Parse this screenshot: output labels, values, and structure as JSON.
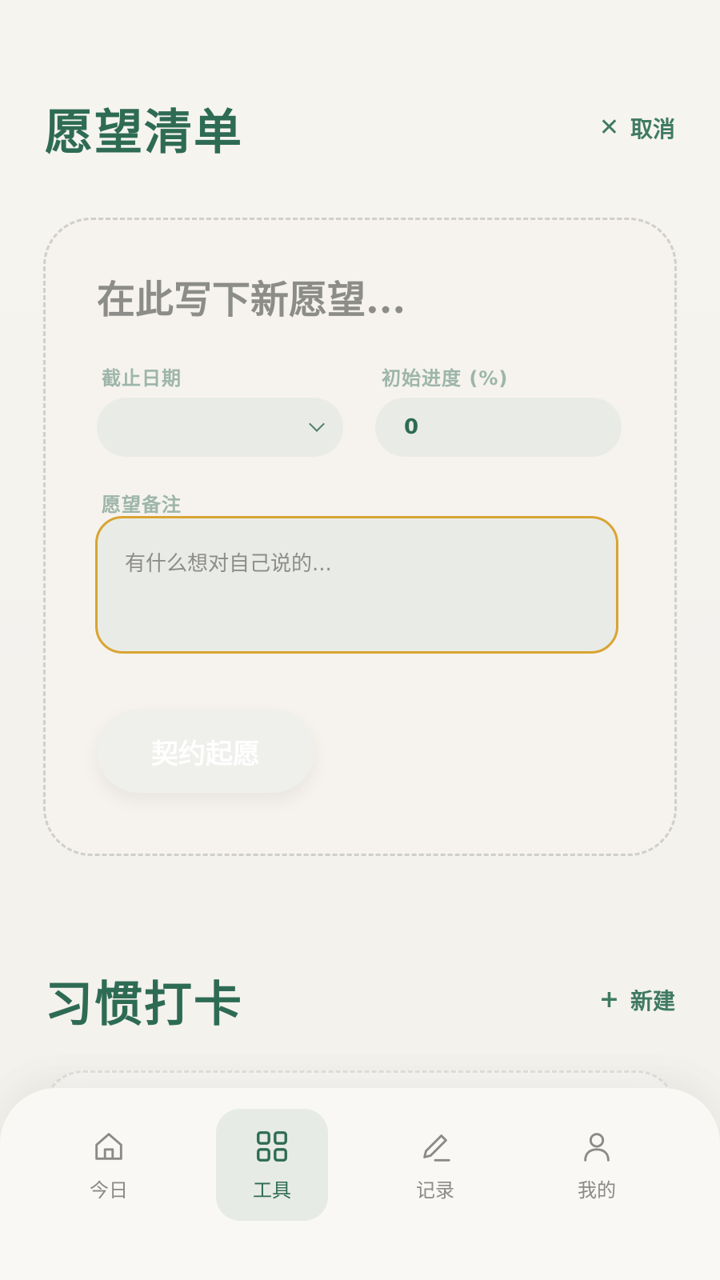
{
  "wishlist": {
    "title": "愿望清单",
    "cancel_label": "取消",
    "form": {
      "wish_placeholder": "在此写下新愿望...",
      "deadline_label": "截止日期",
      "progress_label": "初始进度 (%)",
      "progress_value": "0",
      "note_label": "愿望备注",
      "note_placeholder": "有什么想对自己说的...",
      "submit_label": "契约起愿"
    }
  },
  "habits": {
    "title": "习惯打卡",
    "new_label": "新建"
  },
  "nav": {
    "items": [
      {
        "label": "今日",
        "icon": "home-icon"
      },
      {
        "label": "工具",
        "icon": "grid-icon",
        "active": true
      },
      {
        "label": "记录",
        "icon": "pencil-icon"
      },
      {
        "label": "我的",
        "icon": "user-icon"
      }
    ]
  },
  "colors": {
    "accent": "#2e6b55",
    "note_border": "#d9a433"
  }
}
